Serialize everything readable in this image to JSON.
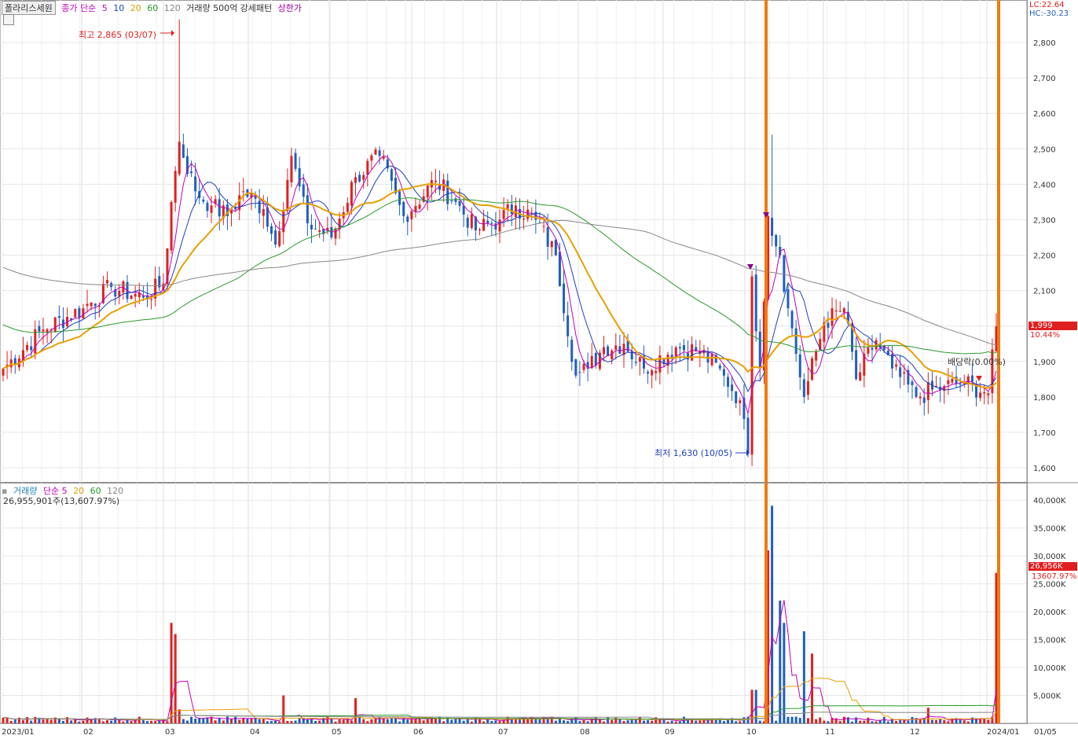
{
  "header": {
    "symbol": "폴라리스세원",
    "price_legend": [
      {
        "text": "종가 단순",
        "color": "#c000c0"
      },
      {
        "text": "5",
        "color": "#c000c0"
      },
      {
        "text": "10",
        "color": "#1f3fbf"
      },
      {
        "text": "20",
        "color": "#e0a000"
      },
      {
        "text": "60",
        "color": "#2a9a2a"
      },
      {
        "text": "120",
        "color": "#888888"
      },
      {
        "text": "거래량 500억 강세패턴",
        "color": "#333333"
      },
      {
        "text": "상한가",
        "color": "#a000a0"
      }
    ],
    "lc_label": "LC:22.64",
    "hc_label": "HC:-30.23"
  },
  "volume_header": {
    "legend": [
      {
        "text": "거래량",
        "color": "#1f7fbf"
      },
      {
        "text": "단순 5",
        "color": "#c000c0"
      },
      {
        "text": "20",
        "color": "#e0a000"
      },
      {
        "text": "60",
        "color": "#2a9a2a"
      },
      {
        "text": "120",
        "color": "#888888"
      }
    ],
    "volume_text": "26,955,901주(13,607.97%)"
  },
  "annotations": {
    "high": "최고 2,865 (03/07)",
    "low": "최저 1,630 (10/05)",
    "dividend": "배당락(0.00%)"
  },
  "price_badge": {
    "value": "1,999",
    "change": "10.44%"
  },
  "volume_badge": {
    "value": "26,956K",
    "change": "13607.97%"
  },
  "chart_data": [
    {
      "type": "candlestick",
      "ylim": [
        1560,
        2920
      ],
      "ytick_labels": [
        "1,600",
        "1,700",
        "1,800",
        "1,900",
        "2,000",
        "2,100",
        "2,200",
        "2,300",
        "2,400",
        "2,500",
        "2,600",
        "2,700",
        "2,800"
      ],
      "ytick_values": [
        1600,
        1700,
        1800,
        1900,
        2000,
        2100,
        2200,
        2300,
        2400,
        2500,
        2600,
        2700,
        2800
      ],
      "x_labels": [
        "2023/01",
        "02",
        "03",
        "04",
        "05",
        "06",
        "07",
        "08",
        "09",
        "10",
        "11",
        "12",
        "2024/01",
        "01/05"
      ],
      "close_anchors": [
        {
          "d": 0,
          "v": 1880
        },
        {
          "d": 10,
          "v": 1990
        },
        {
          "d": 20,
          "v": 2050
        },
        {
          "d": 27,
          "v": 2110
        },
        {
          "d": 35,
          "v": 2080
        },
        {
          "d": 40,
          "v": 2120
        },
        {
          "d": 42,
          "v": 2350
        },
        {
          "d": 44,
          "v": 2520
        },
        {
          "d": 48,
          "v": 2380
        },
        {
          "d": 52,
          "v": 2340
        },
        {
          "d": 56,
          "v": 2310
        },
        {
          "d": 60,
          "v": 2380
        },
        {
          "d": 65,
          "v": 2330
        },
        {
          "d": 68,
          "v": 2230
        },
        {
          "d": 72,
          "v": 2480
        },
        {
          "d": 76,
          "v": 2290
        },
        {
          "d": 82,
          "v": 2250
        },
        {
          "d": 88,
          "v": 2420
        },
        {
          "d": 94,
          "v": 2480
        },
        {
          "d": 100,
          "v": 2310
        },
        {
          "d": 108,
          "v": 2410
        },
        {
          "d": 113,
          "v": 2350
        },
        {
          "d": 118,
          "v": 2270
        },
        {
          "d": 124,
          "v": 2300
        },
        {
          "d": 128,
          "v": 2340
        },
        {
          "d": 133,
          "v": 2300
        },
        {
          "d": 138,
          "v": 2200
        },
        {
          "d": 143,
          "v": 1860
        },
        {
          "d": 146,
          "v": 1880
        },
        {
          "d": 150,
          "v": 1940
        },
        {
          "d": 155,
          "v": 1950
        },
        {
          "d": 160,
          "v": 1880
        },
        {
          "d": 168,
          "v": 1940
        },
        {
          "d": 174,
          "v": 1930
        },
        {
          "d": 180,
          "v": 1860
        },
        {
          "d": 184,
          "v": 1790
        },
        {
          "d": 186,
          "v": 1640
        },
        {
          "d": 187,
          "v": 2140
        },
        {
          "d": 189,
          "v": 1880
        },
        {
          "d": 191,
          "v": 2310
        },
        {
          "d": 194,
          "v": 2200
        },
        {
          "d": 196,
          "v": 2050
        },
        {
          "d": 200,
          "v": 1800
        },
        {
          "d": 205,
          "v": 2010
        },
        {
          "d": 210,
          "v": 2050
        },
        {
          "d": 213,
          "v": 1850
        },
        {
          "d": 218,
          "v": 1960
        },
        {
          "d": 222,
          "v": 1880
        },
        {
          "d": 228,
          "v": 1800
        },
        {
          "d": 235,
          "v": 1830
        },
        {
          "d": 240,
          "v": 1840
        },
        {
          "d": 246,
          "v": 1810
        },
        {
          "d": 248,
          "v": 1999
        }
      ],
      "volume_spikes_k": [
        {
          "d": 42,
          "v": 18000
        },
        {
          "d": 43,
          "v": 16000
        },
        {
          "d": 44,
          "v": 2500
        },
        {
          "d": 70,
          "v": 5000
        },
        {
          "d": 88,
          "v": 4500
        },
        {
          "d": 187,
          "v": 6000
        },
        {
          "d": 188,
          "v": 6000
        },
        {
          "d": 191,
          "v": 31000
        },
        {
          "d": 192,
          "v": 39000
        },
        {
          "d": 194,
          "v": 22000
        },
        {
          "d": 195,
          "v": 18000
        },
        {
          "d": 200,
          "v": 16500
        },
        {
          "d": 202,
          "v": 12500
        },
        {
          "d": 231,
          "v": 2800
        },
        {
          "d": 248,
          "v": 26956
        }
      ],
      "volume_ylim_k": [
        0,
        42000
      ],
      "volume_tick_labels": [
        "5,000K",
        "10,000K",
        "15,000K",
        "20,000K",
        "25,000K",
        "30,000K",
        "35,000K",
        "40,000K"
      ],
      "volume_tick_values": [
        5000,
        10000,
        15000,
        20000,
        25000,
        30000,
        35000,
        40000
      ],
      "colors": {
        "up": "#e02020",
        "down": "#1f5fbf",
        "ma5": "#c000c0",
        "ma10": "#1f3fbf",
        "ma20": "#e8a000",
        "ma60": "#2a9a2a",
        "ma120": "#888888",
        "highlight": "#f07a10"
      }
    }
  ]
}
